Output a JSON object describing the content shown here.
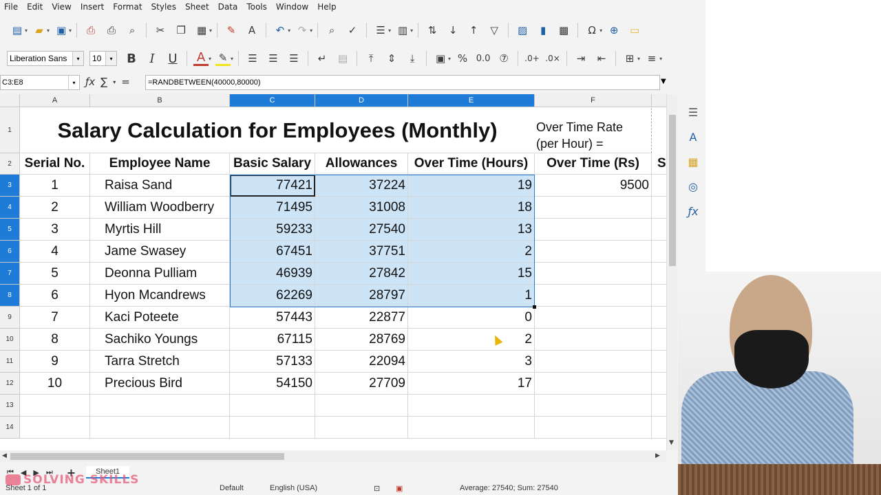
{
  "menu": [
    "File",
    "Edit",
    "View",
    "Insert",
    "Format",
    "Styles",
    "Sheet",
    "Data",
    "Tools",
    "Window",
    "Help"
  ],
  "font": {
    "name": "Liberation Sans",
    "size": "10"
  },
  "namebox": "C3:E8",
  "formula": "=RANDBETWEEN(40000,80000)",
  "columns": [
    "A",
    "B",
    "C",
    "D",
    "E",
    "F"
  ],
  "title": "Salary Calculation for Employees (Monthly)",
  "ot_rate_label_1": "Over Time Rate",
  "ot_rate_label_2": "(per Hour) =",
  "headers": {
    "serial": "Serial No.",
    "name": "Employee Name",
    "basic": "Basic Salary",
    "allow": "Allowances",
    "ot_hours": "Over Time (Hours)",
    "ot_rs": "Over Time (Rs)",
    "next": "S"
  },
  "ot_rate_value": "9500",
  "rows": [
    {
      "serial": "1",
      "name": "Raisa Sand",
      "basic": "77421",
      "allow": "37224",
      "ot": "19"
    },
    {
      "serial": "2",
      "name": "William Woodberry",
      "basic": "71495",
      "allow": "31008",
      "ot": "18"
    },
    {
      "serial": "3",
      "name": "Myrtis Hill",
      "basic": "59233",
      "allow": "27540",
      "ot": "13"
    },
    {
      "serial": "4",
      "name": "Jame Swasey",
      "basic": "67451",
      "allow": "37751",
      "ot": "2"
    },
    {
      "serial": "5",
      "name": "Deonna Pulliam",
      "basic": "46939",
      "allow": "27842",
      "ot": "15"
    },
    {
      "serial": "6",
      "name": "Hyon Mcandrews",
      "basic": "62269",
      "allow": "28797",
      "ot": "1"
    },
    {
      "serial": "7",
      "name": "Kaci Poteete",
      "basic": "57443",
      "allow": "22877",
      "ot": "0"
    },
    {
      "serial": "8",
      "name": "Sachiko Youngs",
      "basic": "67115",
      "allow": "28769",
      "ot": "2"
    },
    {
      "serial": "9",
      "name": "Tarra Stretch",
      "basic": "57133",
      "allow": "22094",
      "ot": "3"
    },
    {
      "serial": "10",
      "name": "Precious Bird",
      "basic": "54150",
      "allow": "27709",
      "ot": "17"
    }
  ],
  "row_numbers": [
    "1",
    "2",
    "3",
    "4",
    "5",
    "6",
    "7",
    "8",
    "9",
    "10",
    "11",
    "12",
    "13",
    "14"
  ],
  "sheet_tab": "Sheet1",
  "watermark": "SOLVING SKILLS",
  "status": {
    "sheet": "Sheet 1 of 1",
    "style": "Default",
    "lang": "English (USA)",
    "summary": "Average: 27540; Sum: 27540"
  },
  "colors": {
    "selection": "#cde3f6",
    "header_selected": "#1f7bd8"
  }
}
